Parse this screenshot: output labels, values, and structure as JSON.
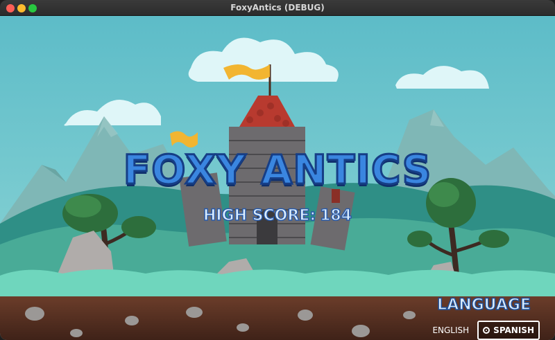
{
  "window": {
    "title": "FoxyAntics (DEBUG)"
  },
  "game": {
    "title": "FOXY ANTICS",
    "high_score_label": "HIGH SCORE:",
    "high_score_value": "184"
  },
  "language": {
    "heading": "LANGUAGE",
    "options": [
      {
        "label": "ENGLISH",
        "selected": false
      },
      {
        "label": "SPANISH",
        "selected": true
      }
    ]
  },
  "colors": {
    "sky": "#6ec6cf",
    "title_fill": "#3a86e0",
    "title_outline": "#163e86",
    "flag": "#f2b531"
  }
}
